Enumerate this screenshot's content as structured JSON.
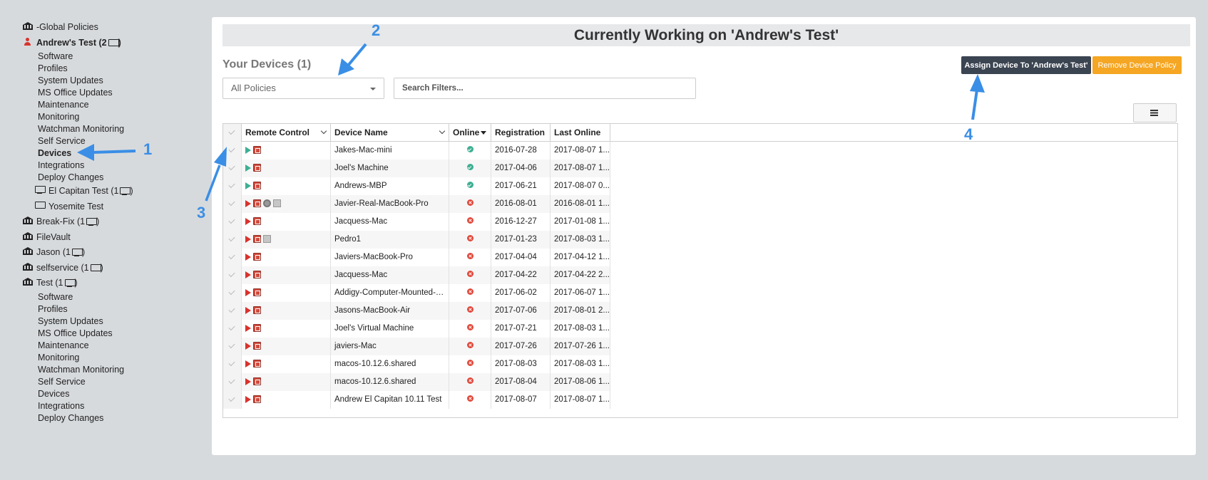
{
  "sidebar": {
    "items": [
      {
        "label": "-Global Policies",
        "icon": "bank-icon"
      },
      {
        "label": "Andrew's Test (2",
        "icon": "user-icon",
        "active": true
      },
      {
        "label": "Break-Fix (1",
        "icon": "bank-icon"
      },
      {
        "label": "FileVault",
        "icon": "bank-icon"
      },
      {
        "label": "Jason (1",
        "icon": "bank-icon"
      },
      {
        "label": "selfservice (1",
        "icon": "bank-icon"
      },
      {
        "label": "Test (1",
        "icon": "bank-icon"
      }
    ],
    "andrews_sub": [
      "Software",
      "Profiles",
      "System Updates",
      "MS Office Updates",
      "Maintenance",
      "Monitoring",
      "Watchman Monitoring",
      "Self Service",
      "Devices",
      "Integrations",
      "Deploy Changes"
    ],
    "andrews_devices": [
      {
        "label": "El Capitan Test (1",
        "icon": "monitor-icon"
      },
      {
        "label": "Yosemite Test",
        "icon": "monitor-icon"
      }
    ],
    "test_sub": [
      "Software",
      "Profiles",
      "System Updates",
      "MS Office Updates",
      "Maintenance",
      "Monitoring",
      "Watchman Monitoring",
      "Self Service",
      "Devices",
      "Integrations",
      "Deploy Changes"
    ],
    "close_paren": ")"
  },
  "header": {
    "title": "Currently Working on 'Andrew's Test'",
    "your_devices": "Your Devices (1)",
    "policy_select": "All Policies",
    "search_placeholder": "Search Filters...",
    "assign_button": "Assign Device To 'Andrew's Test'",
    "remove_button": "Remove Device Policy"
  },
  "grid": {
    "columns": [
      "Remote Control",
      "Device Name",
      "Online",
      "Registration",
      "Last Online"
    ],
    "rows": [
      {
        "name": "Jakes-Mac-mini",
        "online": true,
        "registration": "2016-07-28",
        "last_online": "2017-08-07 1...",
        "extra_icons": []
      },
      {
        "name": "Joel's Machine",
        "online": true,
        "registration": "2017-04-06",
        "last_online": "2017-08-07 1...",
        "extra_icons": []
      },
      {
        "name": "Andrews-MBP",
        "online": true,
        "registration": "2017-06-21",
        "last_online": "2017-08-07 0...",
        "extra_icons": []
      },
      {
        "name": "Javier-Real-MacBook-Pro",
        "online": false,
        "registration": "2016-08-01",
        "last_online": "2016-08-01 1...",
        "extra_icons": [
          "gear",
          "disk"
        ]
      },
      {
        "name": "Jacquess-Mac",
        "online": false,
        "registration": "2016-12-27",
        "last_online": "2017-01-08 1...",
        "extra_icons": []
      },
      {
        "name": "Pedro1",
        "online": false,
        "registration": "2017-01-23",
        "last_online": "2017-08-03 1...",
        "extra_icons": [
          "disk"
        ]
      },
      {
        "name": "Javiers-MacBook-Pro",
        "online": false,
        "registration": "2017-04-04",
        "last_online": "2017-04-12 1...",
        "extra_icons": []
      },
      {
        "name": "Jacquess-Mac",
        "online": false,
        "registration": "2017-04-22",
        "last_online": "2017-04-22 2...",
        "extra_icons": []
      },
      {
        "name": "Addigy-Computer-Mounted-O...",
        "online": false,
        "registration": "2017-06-02",
        "last_online": "2017-06-07 1...",
        "extra_icons": []
      },
      {
        "name": "Jasons-MacBook-Air",
        "online": false,
        "registration": "2017-07-06",
        "last_online": "2017-08-01 2...",
        "extra_icons": []
      },
      {
        "name": "Joel's Virtual Machine",
        "online": false,
        "registration": "2017-07-21",
        "last_online": "2017-08-03 1...",
        "extra_icons": []
      },
      {
        "name": "javiers-Mac",
        "online": false,
        "registration": "2017-07-26",
        "last_online": "2017-07-26 1...",
        "extra_icons": []
      },
      {
        "name": "macos-10.12.6.shared",
        "online": false,
        "registration": "2017-08-03",
        "last_online": "2017-08-03 1...",
        "extra_icons": []
      },
      {
        "name": "macos-10.12.6.shared",
        "online": false,
        "registration": "2017-08-04",
        "last_online": "2017-08-06 1...",
        "extra_icons": []
      },
      {
        "name": "Andrew El Capitan 10.11 Test",
        "online": false,
        "registration": "2017-08-07",
        "last_online": "2017-08-07 1...",
        "extra_icons": []
      }
    ]
  },
  "annotations": [
    "1",
    "2",
    "3",
    "4"
  ],
  "colors": {
    "accent": "#3a8ee6",
    "assign_bg": "#3b4451",
    "remove_bg": "#f5a623",
    "online": "#3daf93",
    "offline": "#e0483b"
  }
}
